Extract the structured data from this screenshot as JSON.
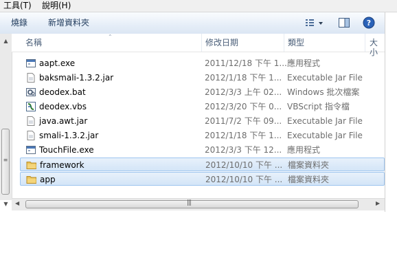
{
  "menu": {
    "tools": "工具(T)",
    "help": "說明(H)"
  },
  "toolbar": {
    "burn": "燒錄",
    "new_folder": "新增資料夾"
  },
  "columns": {
    "name": "名稱",
    "date": "修改日期",
    "type": "類型",
    "size": "大小"
  },
  "files": [
    {
      "name": "aapt.exe",
      "date": "2011/12/18 下午 1...",
      "type": "應用程式",
      "icon": "exe-icon",
      "selected": false
    },
    {
      "name": "baksmali-1.3.2.jar",
      "date": "2012/1/18 下午 1...",
      "type": "Executable Jar File",
      "icon": "jar-icon",
      "selected": false
    },
    {
      "name": "deodex.bat",
      "date": "2012/3/3 上午 02...",
      "type": "Windows 批次檔案",
      "icon": "bat-icon",
      "selected": false
    },
    {
      "name": "deodex.vbs",
      "date": "2012/3/20 下午 0...",
      "type": "VBScript 指令檔",
      "icon": "vbs-icon",
      "selected": false
    },
    {
      "name": "java.awt.jar",
      "date": "2011/7/2 下午 09...",
      "type": "Executable Jar File",
      "icon": "jar-icon",
      "selected": false
    },
    {
      "name": "smali-1.3.2.jar",
      "date": "2012/1/18 下午 1...",
      "type": "Executable Jar File",
      "icon": "jar-icon",
      "selected": false
    },
    {
      "name": "TouchFile.exe",
      "date": "2012/3/3 下午 12...",
      "type": "應用程式",
      "icon": "exe-icon",
      "selected": false
    },
    {
      "name": "framework",
      "date": "2012/10/10 下午 ...",
      "type": "檔案資料夾",
      "icon": "folder-icon",
      "selected": true
    },
    {
      "name": "app",
      "date": "2012/10/10 下午 ...",
      "type": "檔案資料夾",
      "icon": "folder-icon",
      "selected": true
    }
  ],
  "colors": {
    "selection_border": "#9ec5ef",
    "selection_fill": "#d3e5f7",
    "toolbar_text": "#1e395b",
    "header_text": "#4c607a"
  }
}
